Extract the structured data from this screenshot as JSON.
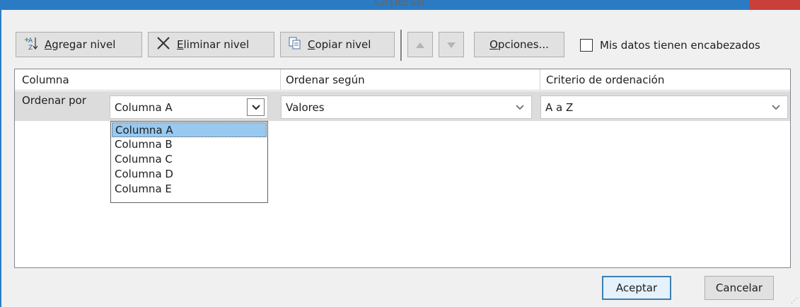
{
  "window": {
    "title": "Ordenar"
  },
  "toolbar": {
    "add_level": {
      "prefix": "",
      "accel": "A",
      "rest": "gregar nivel"
    },
    "delete_level": {
      "prefix": "",
      "accel": "E",
      "rest": "liminar nivel"
    },
    "copy_level": {
      "prefix": "",
      "accel": "C",
      "rest": "opiar nivel"
    },
    "options": {
      "prefix": "",
      "accel": "O",
      "rest": "pciones..."
    },
    "header_checkbox": {
      "accel": "M",
      "rest": "is datos tienen encabezados",
      "checked": false
    }
  },
  "columns": {
    "col1": "Columna",
    "col2": "Ordenar según",
    "col3": "Criterio de ordenación"
  },
  "sort_row": {
    "label": "Ordenar por",
    "column_value": "Columna A",
    "sort_on_value": "Valores",
    "order_value": "A a Z"
  },
  "dropdown": {
    "options": [
      "Columna A",
      "Columna B",
      "Columna C",
      "Columna D",
      "Columna E"
    ],
    "selected_index": 0
  },
  "footer": {
    "ok_label": "Aceptar",
    "cancel_label": "Cancelar"
  },
  "colors": {
    "accent": "#2b7bc4",
    "selection": "#99c9ef",
    "close": "#c9403a"
  },
  "icons": [
    "sort-az-icon",
    "delete-x-icon",
    "copy-icon",
    "up-arrow-icon",
    "down-arrow-icon",
    "chevron-down-icon"
  ]
}
